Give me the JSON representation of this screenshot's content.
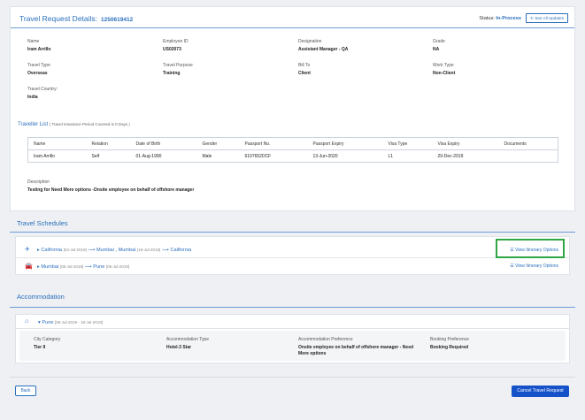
{
  "header": {
    "title": "Travel Request Details:",
    "request_id": "1250619412",
    "status_label": "Status:",
    "status_value": "In-Process",
    "see_all_updates": "See All Updates"
  },
  "fields": [
    {
      "label": "Name",
      "value": "Iram Arrillo"
    },
    {
      "label": "Employee ID",
      "value": "US02073"
    },
    {
      "label": "Designation",
      "value": "Assistant Manager - QA"
    },
    {
      "label": "Grade",
      "value": "NA"
    },
    {
      "label": "Travel Type",
      "value": "Overseas"
    },
    {
      "label": "Travel Purpose",
      "value": "Training"
    },
    {
      "label": "Bill To",
      "value": "Client"
    },
    {
      "label": "Work Type",
      "value": "Non-Client"
    },
    {
      "label": "Travel Country:",
      "value": "India"
    }
  ],
  "traveller_list": {
    "title": "Traveller List",
    "note": "( Travel Insurance Period Covered is 0 Days )",
    "columns": [
      "Name",
      "Relation",
      "Date of Birth",
      "Gender",
      "Passport No.",
      "Passport Expiry",
      "Visa Type",
      "Visa Expiry",
      "Documents"
    ],
    "rows": [
      [
        "Iram Arrillo",
        "Self",
        "01-Aug-1990",
        "Male",
        "6107652DCF",
        "13-Jun-2020",
        "L1",
        "29-Dec-2019",
        ""
      ]
    ]
  },
  "description": {
    "label": "Description",
    "value": "Testing for Need More options -Onsite employee on behalf of offshore manager"
  },
  "travel_schedules": {
    "title": "Travel Schedules",
    "rows": [
      {
        "icon": "plane-icon",
        "from": "California",
        "from_date": "[04-Jul-2019]",
        "mid": "Mumbai , Mumbai",
        "mid_date": "[18-Jul-2019]",
        "to": "California",
        "action": "View Itinerary Options"
      },
      {
        "icon": "car-icon",
        "from": "Mumbai",
        "from_date": "[05-Jul-2019]",
        "to": "Pune",
        "to_date": "[05-Jul-2019]",
        "action": "View Itinerary Options"
      }
    ]
  },
  "accommodation": {
    "title": "Accommodation",
    "location": "Pune",
    "dates": "[05-Jul-2019 - 18-Jul-2019]",
    "fields": [
      {
        "label": "City Category",
        "value": "Tier II"
      },
      {
        "label": "Accommodation Type",
        "value": "Hotel-3 Star"
      },
      {
        "label": "Accommodation Preference",
        "value": "Onsite employee on behalf of offshore manager - Need More options"
      },
      {
        "label": "Booking Preference",
        "value": "Booking Required"
      }
    ]
  },
  "footer": {
    "back": "Back",
    "cancel": "Cancel Travel Request"
  },
  "colors": {
    "accent": "#2a6fbd",
    "primary_button": "#1552c9",
    "highlight": "#2fa544"
  }
}
